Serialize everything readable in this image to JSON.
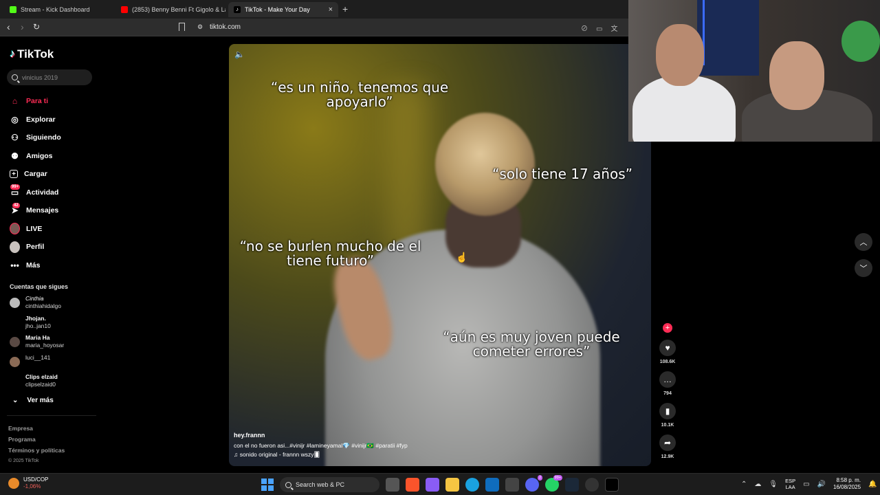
{
  "browser": {
    "tabs": [
      {
        "title": "Stream - Kick Dashboard",
        "favicon_color": "#53fc18"
      },
      {
        "title": "(2853) Benny Benni Ft Gigolo & La E",
        "favicon_color": "#ff0000"
      },
      {
        "title": "TikTok - Make Your Day",
        "favicon_color": "#000000"
      }
    ],
    "new_tab": "+",
    "close": "×",
    "url": "tiktok.com"
  },
  "sidebar": {
    "logo": "TikTok",
    "search_placeholder": "vinicius 2019",
    "nav": [
      {
        "label": "Para ti",
        "icon": "home-icon",
        "active": true
      },
      {
        "label": "Explorar",
        "icon": "compass-icon"
      },
      {
        "label": "Siguiendo",
        "icon": "user-plus-icon"
      },
      {
        "label": "Amigos",
        "icon": "users-icon"
      },
      {
        "label": "Cargar",
        "icon": "upload-icon"
      },
      {
        "label": "Actividad",
        "icon": "inbox-icon",
        "badge": "99+"
      },
      {
        "label": "Mensajes",
        "icon": "message-icon",
        "badge": "42"
      },
      {
        "label": "LIVE",
        "icon": "live-icon"
      },
      {
        "label": "Perfil",
        "icon": "profile-icon"
      },
      {
        "label": "Más",
        "icon": "ellipsis-icon"
      }
    ],
    "following_title": "Cuentas que sigues",
    "following": [
      {
        "name": "Cinthia",
        "user": "cinthiahidalgo"
      },
      {
        "name": "Jhojan.",
        "user": "jho..jan10"
      },
      {
        "name": "Maria Ha",
        "user": "maria_hoyosar"
      },
      {
        "name": "",
        "user": "luci__141"
      },
      {
        "name": "Clips elzaid",
        "user": "clipselzaid0"
      }
    ],
    "see_more": "Ver más",
    "footer": [
      "Empresa",
      "Programa",
      "Términos y políticas"
    ],
    "copyright": "© 2025 TikTok"
  },
  "video": {
    "captions": [
      "“es un niño, tenemos que apoyarlo”",
      "“solo tiene 17 años”",
      "“no se burlen mucho de el tiene futuro”",
      "“aún es muy joven puede cometer errores”"
    ],
    "author": "hey.frannn",
    "description": "con el no fueron asi...#vinijr #lamineyamal💎 #vinijr🇧🇷 #paratii #fyp",
    "sound": "♫ sonido original - frannn wszy🂠",
    "likes": "108.6K",
    "comments": "794",
    "saves": "10.1K",
    "shares": "12.9K"
  },
  "taskbar": {
    "ticker": "USD/COP",
    "change": "-1,06%",
    "search": "Search web & PC",
    "badge_1": "2",
    "badge_2": "99+",
    "lang_1": "ESP",
    "lang_2": "LAA",
    "time": "8:58 p. m.",
    "date": "16/08/2025"
  }
}
